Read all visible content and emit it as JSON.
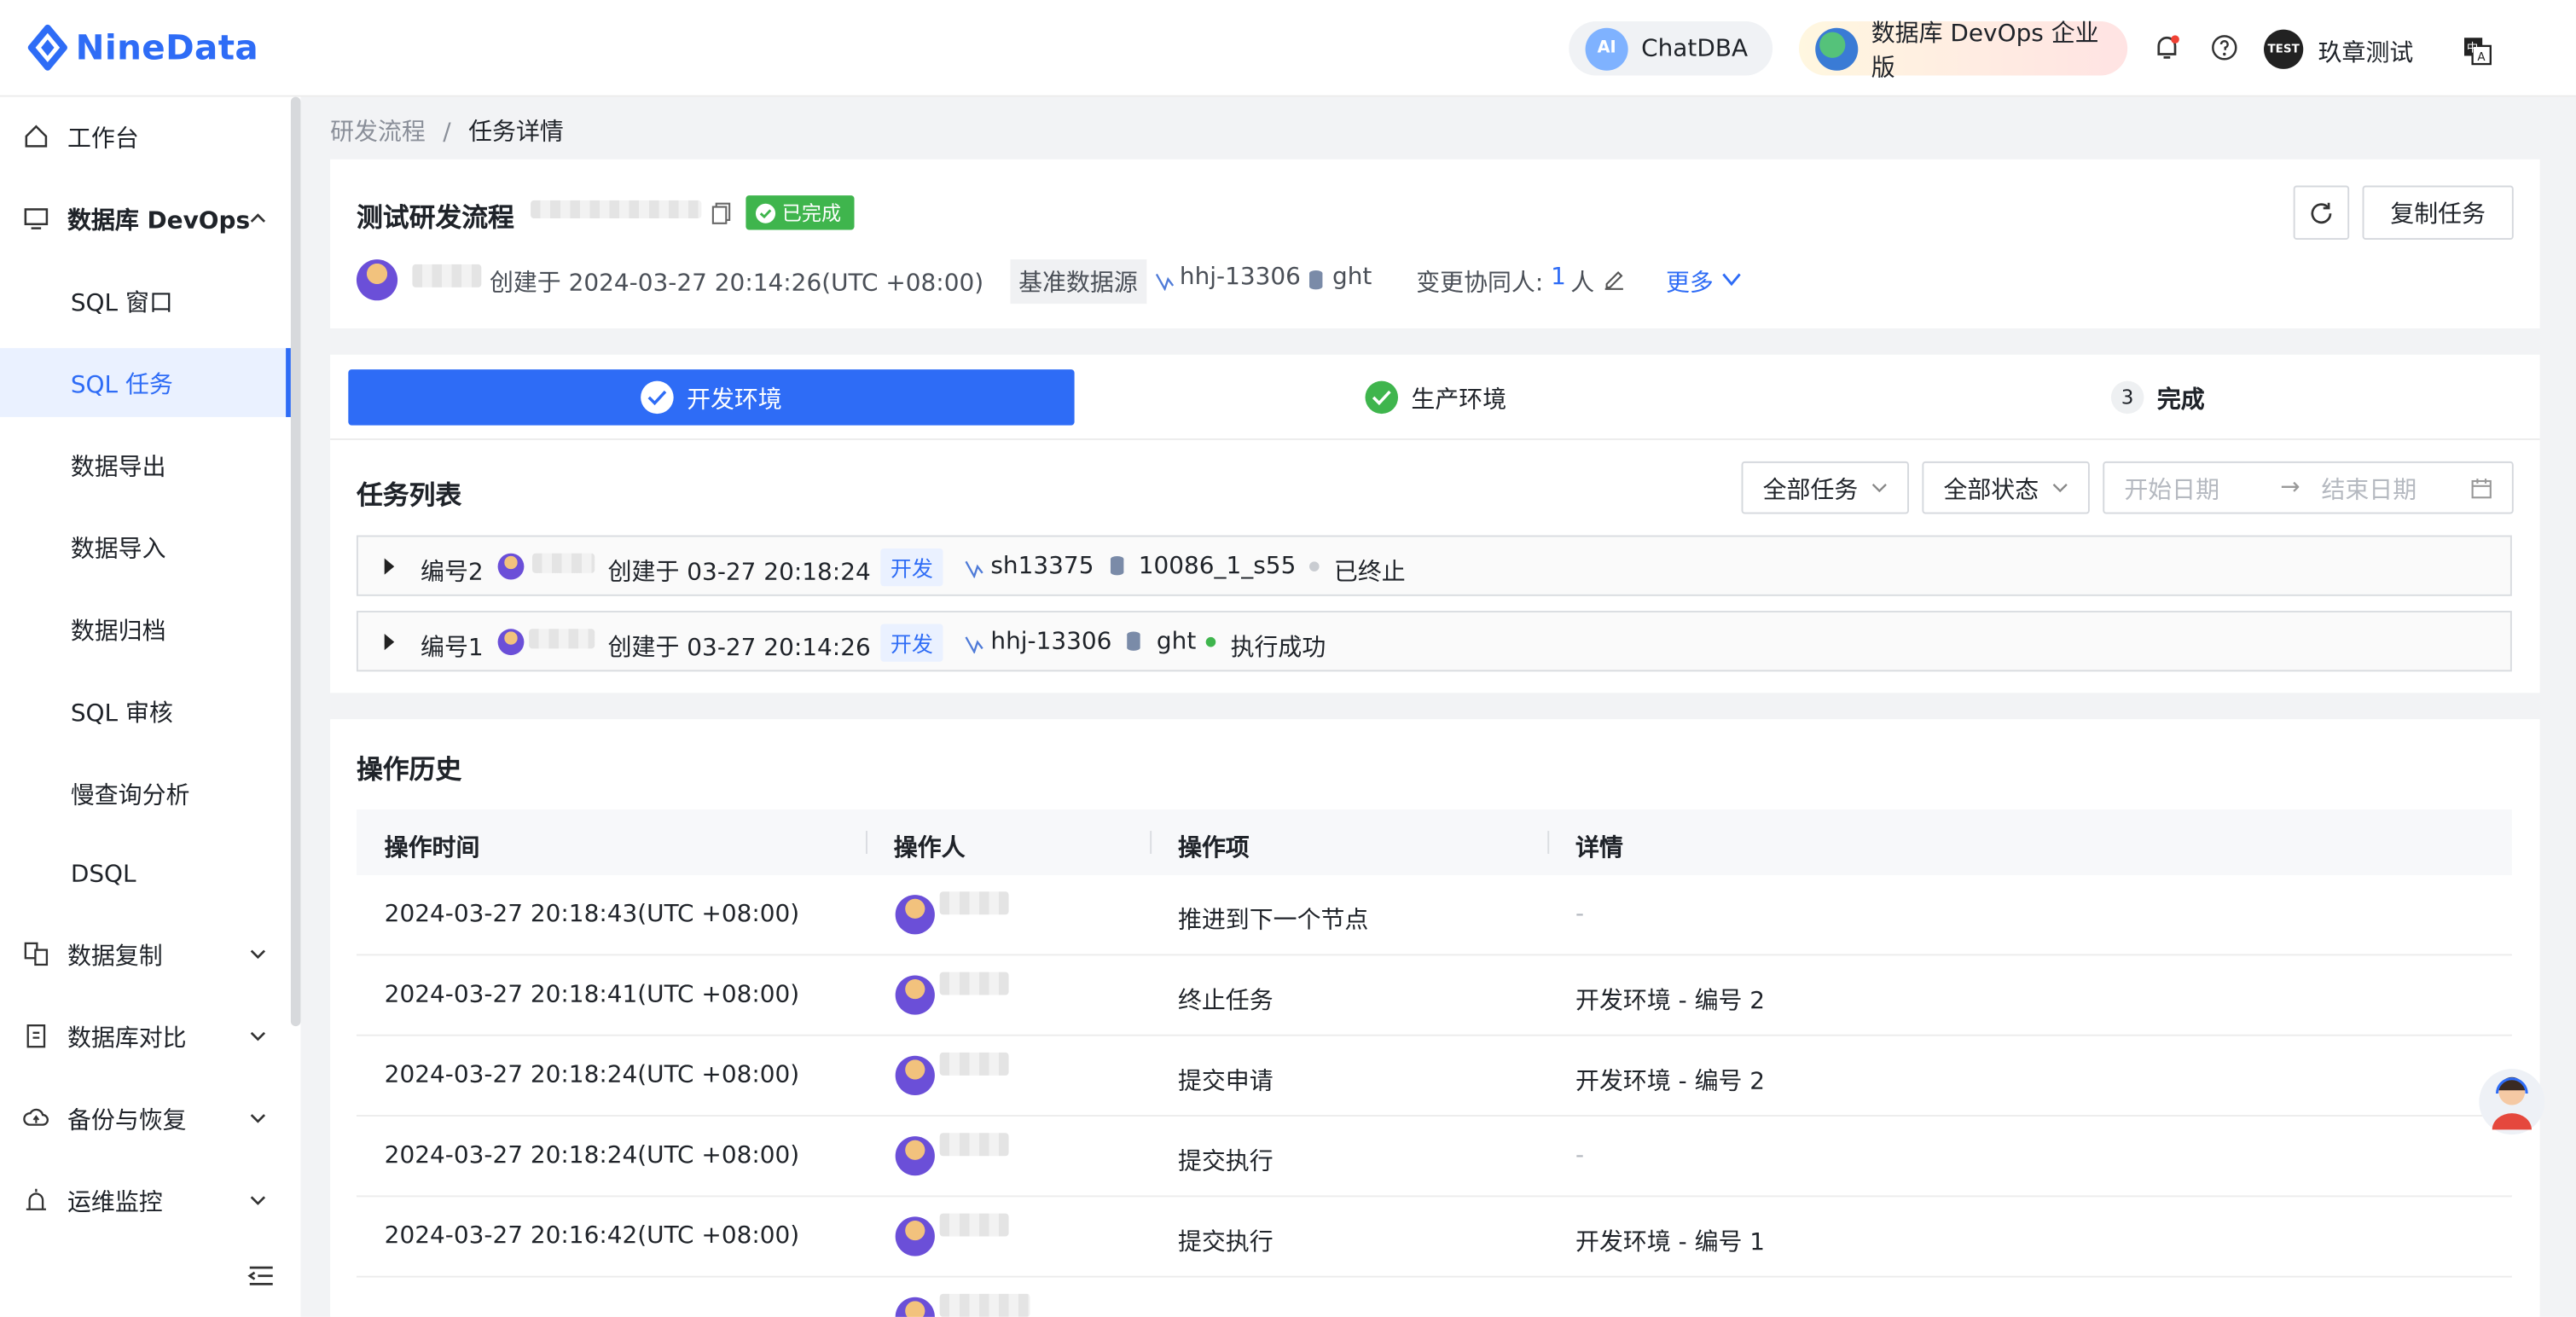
{
  "app": {
    "brand": "NineData"
  },
  "topbar": {
    "chatdba_label": "ChatDBA",
    "devops_label": "数据库 DevOps 企业版",
    "user_avatar_text": "TEST",
    "user_name": "玖章测试",
    "icons": [
      "bell-icon",
      "help-icon",
      "translate-icon"
    ]
  },
  "sidebar": {
    "items": [
      {
        "label": "工作台",
        "icon": "home-icon"
      },
      {
        "label": "数据库 DevOps",
        "icon": "devops-icon",
        "expanded": true
      },
      {
        "label": "SQL 窗口"
      },
      {
        "label": "SQL 任务",
        "active": true
      },
      {
        "label": "数据导出"
      },
      {
        "label": "数据导入"
      },
      {
        "label": "数据归档"
      },
      {
        "label": "SQL 审核"
      },
      {
        "label": "慢查询分析"
      },
      {
        "label": "DSQL"
      },
      {
        "label": "数据复制",
        "icon": "replication-icon"
      },
      {
        "label": "数据库对比",
        "icon": "compare-icon"
      },
      {
        "label": "备份与恢复",
        "icon": "backup-icon"
      },
      {
        "label": "运维监控",
        "icon": "monitor-icon"
      }
    ]
  },
  "breadcrumb": {
    "parent": "研发流程",
    "separator": "/",
    "current": "任务详情"
  },
  "header": {
    "title": "测试研发流程",
    "status_badge": "已完成",
    "created_text": "创建于 2024-03-27 20:14:26(UTC +08:00)",
    "datasource_label": "基准数据源",
    "datasource_name": "hhj-13306",
    "database_name": "ght",
    "collaborator_label": "变更协同人:",
    "collaborator_count": "1",
    "collaborator_unit": "人",
    "more_label": "更多",
    "refresh_icon": "refresh-icon",
    "copy_task_label": "复制任务"
  },
  "steps": [
    {
      "label": "开发环境",
      "state": "active"
    },
    {
      "label": "生产环境",
      "state": "done"
    },
    {
      "label": "完成",
      "state": "pending",
      "number": "3"
    }
  ],
  "task_list": {
    "title": "任务列表",
    "filter_all_tasks": "全部任务",
    "filter_all_status": "全部状态",
    "start_date_placeholder": "开始日期",
    "end_date_placeholder": "结束日期",
    "arrow": "→",
    "rows": [
      {
        "number": "编号2",
        "created": "创建于 03-27 20:18:24",
        "env_tag": "开发",
        "datasource": "sh13375",
        "database": "10086_1_s55",
        "status": "已终止",
        "status_color": "#c9ccd1"
      },
      {
        "number": "编号1",
        "created": "创建于 03-27 20:14:26",
        "env_tag": "开发",
        "datasource": "hhj-13306",
        "database": "ght",
        "status": "执行成功",
        "status_color": "#3fb54d"
      }
    ]
  },
  "history": {
    "title": "操作历史",
    "columns": [
      "操作时间",
      "操作人",
      "操作项",
      "详情"
    ],
    "rows": [
      {
        "time": "2024-03-27 20:18:43(UTC +08:00)",
        "action": "推进到下一个节点",
        "detail": "-"
      },
      {
        "time": "2024-03-27 20:18:41(UTC +08:00)",
        "action": "终止任务",
        "detail": "开发环境 - 编号 2"
      },
      {
        "time": "2024-03-27 20:18:24(UTC +08:00)",
        "action": "提交申请",
        "detail": "开发环境 - 编号 2"
      },
      {
        "time": "2024-03-27 20:18:24(UTC +08:00)",
        "action": "提交执行",
        "detail": "-"
      },
      {
        "time": "2024-03-27 20:16:42(UTC +08:00)",
        "action": "提交执行",
        "detail": "开发环境 - 编号 1"
      }
    ]
  },
  "colors": {
    "primary": "#2e6cf6",
    "success": "#3fb54d"
  }
}
